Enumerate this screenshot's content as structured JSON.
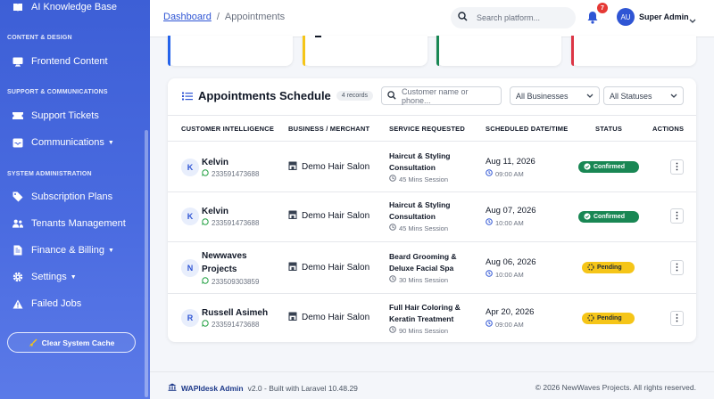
{
  "sidebar": {
    "top_item": "AI Knowledge Base",
    "sections": {
      "content": "CONTENT & DESIGN",
      "support": "SUPPORT & COMMUNICATIONS",
      "system": "SYSTEM ADMINISTRATION"
    },
    "items": {
      "frontend": "Frontend Content",
      "tickets": "Support Tickets",
      "communications": "Communications",
      "subscriptions": "Subscription Plans",
      "tenants": "Tenants Management",
      "finance": "Finance & Billing",
      "settings": "Settings",
      "failed_jobs": "Failed Jobs"
    },
    "cache_button": "Clear System Cache"
  },
  "topbar": {
    "breadcrumb_link": "Dashboard",
    "breadcrumb_sep": "/",
    "breadcrumb_current": "Appointments",
    "search_placeholder": "Search platform...",
    "notification_count": "7",
    "avatar_initials": "AU",
    "user_name": "Super Admin"
  },
  "colors": {
    "accent": "#2f55d4",
    "stat_cards": [
      "#2563eb",
      "#f5c518",
      "#198754",
      "#dc3545"
    ],
    "confirmed": "#198754",
    "pending": "#f5c518"
  },
  "card": {
    "title": "Appointments Schedule",
    "record_count": "4 records",
    "search_placeholder": "Customer name or phone...",
    "business_filter": "All Businesses",
    "status_filter": "All Statuses"
  },
  "table": {
    "headers": {
      "customer": "CUSTOMER INTELLIGENCE",
      "business": "BUSINESS / MERCHANT",
      "service": "SERVICE REQUESTED",
      "date": "SCHEDULED DATE/TIME",
      "status": "STATUS",
      "actions": "ACTIONS"
    },
    "rows": [
      {
        "initial": "K",
        "name": "Kelvin",
        "name2": "",
        "phone": "233591473688",
        "business": "Demo Hair Salon",
        "service1": "Haircut & Styling",
        "service2": "Consultation",
        "duration": "45 Mins Session",
        "date": "Aug 11, 2026",
        "time": "09:00 AM",
        "status": "Confirmed"
      },
      {
        "initial": "K",
        "name": "Kelvin",
        "name2": "",
        "phone": "233591473688",
        "business": "Demo Hair Salon",
        "service1": "Haircut & Styling",
        "service2": "Consultation",
        "duration": "45 Mins Session",
        "date": "Aug 07, 2026",
        "time": "10:00 AM",
        "status": "Confirmed"
      },
      {
        "initial": "N",
        "name": "Newwaves",
        "name2": "Projects",
        "phone": "233509303859",
        "business": "Demo Hair Salon",
        "service1": "Beard Grooming &",
        "service2": "Deluxe Facial Spa",
        "duration": "30 Mins Session",
        "date": "Aug 06, 2026",
        "time": "10:00 AM",
        "status": "Pending"
      },
      {
        "initial": "R",
        "name": "Russell Asimeh",
        "name2": "",
        "phone": "233591473688",
        "business": "Demo Hair Salon",
        "service1": "Full Hair Coloring &",
        "service2": "Keratin Treatment",
        "duration": "90 Mins Session",
        "date": "Apr 20, 2026",
        "time": "09:00 AM",
        "status": "Pending"
      }
    ],
    "action_glyph": "⋮"
  },
  "footer": {
    "brand": "WAPIdesk Admin",
    "version_text": "v2.0 - Built with Laravel 10.48.29",
    "copyright": "© 2026 NewWaves Projects. All rights reserved."
  }
}
